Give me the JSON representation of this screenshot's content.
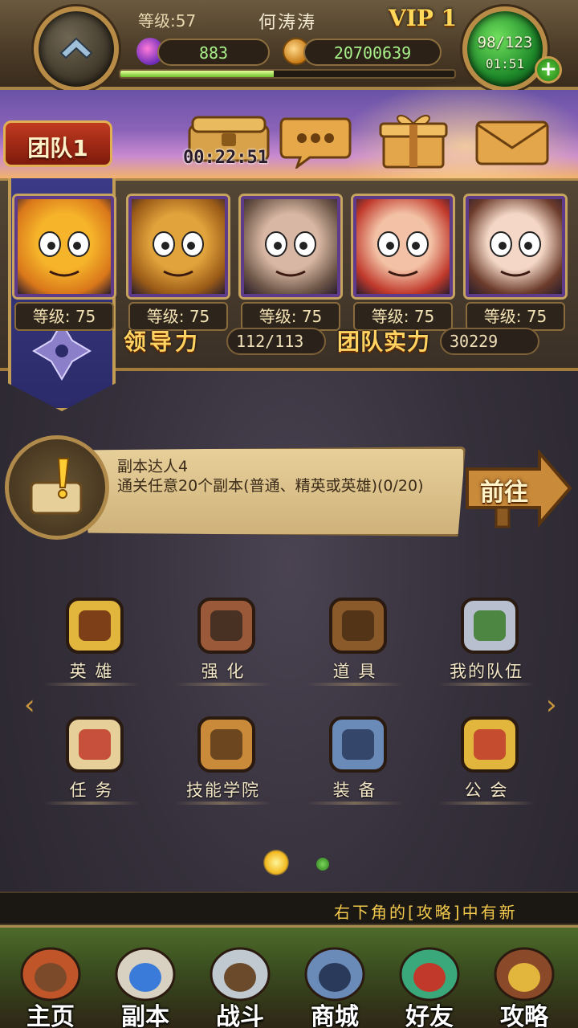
{
  "status_bar": {
    "level_label": "等级:57",
    "player_name": "何涛涛",
    "vip_label": "VIP 1",
    "gems": "883",
    "gold": "20700639",
    "energy": "98/123",
    "energy_timer": "01:51",
    "xp_progress": 0.46
  },
  "banner": {
    "team_label": "团队1",
    "chest_timer": "00:22:51",
    "buttons": [
      "chest-icon",
      "chat-bubble-icon",
      "gift-icon",
      "mail-icon"
    ]
  },
  "heroes": [
    {
      "level": "等级: 75",
      "colors": [
        "#f6b42a",
        "#d9771a"
      ]
    },
    {
      "level": "等级: 75",
      "colors": [
        "#e1a33b",
        "#9a5b17"
      ]
    },
    {
      "level": "等级: 75",
      "colors": [
        "#d8b8a4",
        "#6e5748"
      ]
    },
    {
      "level": "等级: 75",
      "colors": [
        "#f3c2a6",
        "#c0392b"
      ]
    },
    {
      "level": "等级: 75",
      "colors": [
        "#f4d7c6",
        "#6b3b2b"
      ]
    }
  ],
  "stats": {
    "leadership_label": "领导力",
    "leadership_value": "112/113",
    "team_power_label": "团队实力",
    "team_power_value": "30229"
  },
  "quest": {
    "title": "副本达人4",
    "description": "通关任意20个副本(普通、精英或英雄)(0/20)",
    "go_button": "前往"
  },
  "menu": [
    {
      "label": "英 雄",
      "icon": "hero-card-icon"
    },
    {
      "label": "强 化",
      "icon": "helmet-icon"
    },
    {
      "label": "道 具",
      "icon": "backpack-icon"
    },
    {
      "label": "我的队伍",
      "icon": "crossed-swords-icon"
    },
    {
      "label": "任 务",
      "icon": "quest-scroll-icon"
    },
    {
      "label": "技能学院",
      "icon": "spellbook-icon"
    },
    {
      "label": "装 备",
      "icon": "anvil-icon"
    },
    {
      "label": "公 会",
      "icon": "guild-shield-icon"
    }
  ],
  "ticker": "右下角的[攻略]中有新",
  "bottom_nav": [
    {
      "label": "主页",
      "icon": "home-hut-icon"
    },
    {
      "label": "副本",
      "icon": "dungeon-skull-icon"
    },
    {
      "label": "战斗",
      "icon": "battle-axe-icon"
    },
    {
      "label": "商城",
      "icon": "shop-monster-icon"
    },
    {
      "label": "好友",
      "icon": "friends-icon"
    },
    {
      "label": "攻略",
      "icon": "guide-book-icon"
    }
  ],
  "colors": {
    "gold": "#ffd361",
    "parchment": "#e7cf9a",
    "hero_frame": "#5e3b8a",
    "accent_green": "#6ec12d"
  }
}
